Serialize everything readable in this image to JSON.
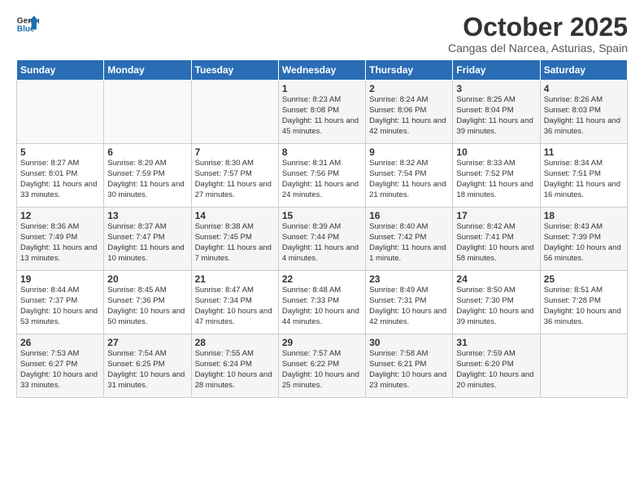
{
  "logo": {
    "line1": "General",
    "line2": "Blue"
  },
  "title": "October 2025",
  "subtitle": "Cangas del Narcea, Asturias, Spain",
  "weekdays": [
    "Sunday",
    "Monday",
    "Tuesday",
    "Wednesday",
    "Thursday",
    "Friday",
    "Saturday"
  ],
  "weeks": [
    [
      {
        "day": "",
        "info": ""
      },
      {
        "day": "",
        "info": ""
      },
      {
        "day": "",
        "info": ""
      },
      {
        "day": "1",
        "info": "Sunrise: 8:23 AM\nSunset: 8:08 PM\nDaylight: 11 hours\nand 45 minutes."
      },
      {
        "day": "2",
        "info": "Sunrise: 8:24 AM\nSunset: 8:06 PM\nDaylight: 11 hours\nand 42 minutes."
      },
      {
        "day": "3",
        "info": "Sunrise: 8:25 AM\nSunset: 8:04 PM\nDaylight: 11 hours\nand 39 minutes."
      },
      {
        "day": "4",
        "info": "Sunrise: 8:26 AM\nSunset: 8:03 PM\nDaylight: 11 hours\nand 36 minutes."
      }
    ],
    [
      {
        "day": "5",
        "info": "Sunrise: 8:27 AM\nSunset: 8:01 PM\nDaylight: 11 hours\nand 33 minutes."
      },
      {
        "day": "6",
        "info": "Sunrise: 8:29 AM\nSunset: 7:59 PM\nDaylight: 11 hours\nand 30 minutes."
      },
      {
        "day": "7",
        "info": "Sunrise: 8:30 AM\nSunset: 7:57 PM\nDaylight: 11 hours\nand 27 minutes."
      },
      {
        "day": "8",
        "info": "Sunrise: 8:31 AM\nSunset: 7:56 PM\nDaylight: 11 hours\nand 24 minutes."
      },
      {
        "day": "9",
        "info": "Sunrise: 8:32 AM\nSunset: 7:54 PM\nDaylight: 11 hours\nand 21 minutes."
      },
      {
        "day": "10",
        "info": "Sunrise: 8:33 AM\nSunset: 7:52 PM\nDaylight: 11 hours\nand 18 minutes."
      },
      {
        "day": "11",
        "info": "Sunrise: 8:34 AM\nSunset: 7:51 PM\nDaylight: 11 hours\nand 16 minutes."
      }
    ],
    [
      {
        "day": "12",
        "info": "Sunrise: 8:36 AM\nSunset: 7:49 PM\nDaylight: 11 hours\nand 13 minutes."
      },
      {
        "day": "13",
        "info": "Sunrise: 8:37 AM\nSunset: 7:47 PM\nDaylight: 11 hours\nand 10 minutes."
      },
      {
        "day": "14",
        "info": "Sunrise: 8:38 AM\nSunset: 7:45 PM\nDaylight: 11 hours\nand 7 minutes."
      },
      {
        "day": "15",
        "info": "Sunrise: 8:39 AM\nSunset: 7:44 PM\nDaylight: 11 hours\nand 4 minutes."
      },
      {
        "day": "16",
        "info": "Sunrise: 8:40 AM\nSunset: 7:42 PM\nDaylight: 11 hours\nand 1 minute."
      },
      {
        "day": "17",
        "info": "Sunrise: 8:42 AM\nSunset: 7:41 PM\nDaylight: 10 hours\nand 58 minutes."
      },
      {
        "day": "18",
        "info": "Sunrise: 8:43 AM\nSunset: 7:39 PM\nDaylight: 10 hours\nand 56 minutes."
      }
    ],
    [
      {
        "day": "19",
        "info": "Sunrise: 8:44 AM\nSunset: 7:37 PM\nDaylight: 10 hours\nand 53 minutes."
      },
      {
        "day": "20",
        "info": "Sunrise: 8:45 AM\nSunset: 7:36 PM\nDaylight: 10 hours\nand 50 minutes."
      },
      {
        "day": "21",
        "info": "Sunrise: 8:47 AM\nSunset: 7:34 PM\nDaylight: 10 hours\nand 47 minutes."
      },
      {
        "day": "22",
        "info": "Sunrise: 8:48 AM\nSunset: 7:33 PM\nDaylight: 10 hours\nand 44 minutes."
      },
      {
        "day": "23",
        "info": "Sunrise: 8:49 AM\nSunset: 7:31 PM\nDaylight: 10 hours\nand 42 minutes."
      },
      {
        "day": "24",
        "info": "Sunrise: 8:50 AM\nSunset: 7:30 PM\nDaylight: 10 hours\nand 39 minutes."
      },
      {
        "day": "25",
        "info": "Sunrise: 8:51 AM\nSunset: 7:28 PM\nDaylight: 10 hours\nand 36 minutes."
      }
    ],
    [
      {
        "day": "26",
        "info": "Sunrise: 7:53 AM\nSunset: 6:27 PM\nDaylight: 10 hours\nand 33 minutes."
      },
      {
        "day": "27",
        "info": "Sunrise: 7:54 AM\nSunset: 6:25 PM\nDaylight: 10 hours\nand 31 minutes."
      },
      {
        "day": "28",
        "info": "Sunrise: 7:55 AM\nSunset: 6:24 PM\nDaylight: 10 hours\nand 28 minutes."
      },
      {
        "day": "29",
        "info": "Sunrise: 7:57 AM\nSunset: 6:22 PM\nDaylight: 10 hours\nand 25 minutes."
      },
      {
        "day": "30",
        "info": "Sunrise: 7:58 AM\nSunset: 6:21 PM\nDaylight: 10 hours\nand 23 minutes."
      },
      {
        "day": "31",
        "info": "Sunrise: 7:59 AM\nSunset: 6:20 PM\nDaylight: 10 hours\nand 20 minutes."
      },
      {
        "day": "",
        "info": ""
      }
    ]
  ]
}
